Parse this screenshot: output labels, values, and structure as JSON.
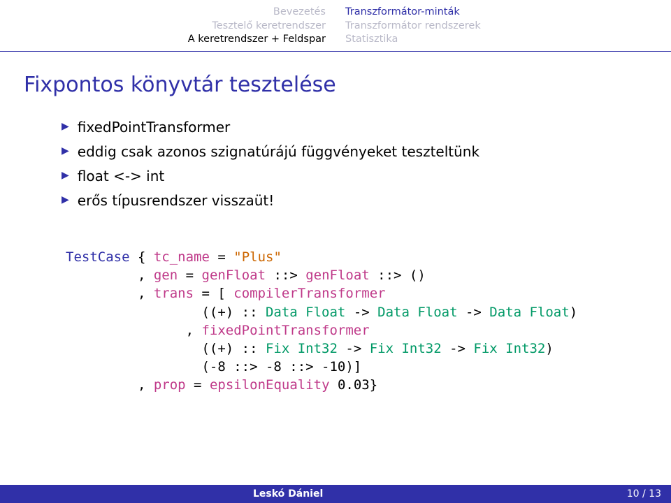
{
  "header": {
    "left": [
      "Bevezetés",
      "Tesztelő keretrendszer",
      "A keretrendszer + Feldspar"
    ],
    "right": [
      "Transzformátor-minták",
      "Transzformátor rendszerek",
      "Statisztika"
    ],
    "active_left_index": 2,
    "active_right_index": 0
  },
  "title": "Fixpontos könyvtár tesztelése",
  "bullets": [
    "fixedPointTransformer",
    "eddig csak azonos szignatúrájú függvényeket teszteltünk",
    "float <-> int",
    "erős típusrendszer visszaüt!"
  ],
  "code": {
    "l1_a": "TestCase",
    "l1_b": " { ",
    "l1_c": "tc_name",
    "l1_d": " = ",
    "l1_e": "\"Plus\"",
    "l2_a": "         , ",
    "l2_b": "gen",
    "l2_c": " = ",
    "l2_d": "genFloat",
    "l2_e": " ::> ",
    "l2_f": "genFloat",
    "l2_g": " ::> ()",
    "l3_a": "         , ",
    "l3_b": "trans",
    "l3_c": " = [ ",
    "l3_d": "compilerTransformer",
    "l4_a": "                 ((+) :: ",
    "l4_b": "Data Float",
    "l4_c": " -> ",
    "l4_d": "Data Float",
    "l4_e": " -> ",
    "l4_f": "Data Float",
    "l4_g": ")",
    "l5_a": "               , ",
    "l5_b": "fixedPointTransformer",
    "l6_a": "                 ((+) :: ",
    "l6_b": "Fix Int32",
    "l6_c": " -> ",
    "l6_d": "Fix Int32",
    "l6_e": " -> ",
    "l6_f": "Fix Int32",
    "l6_g": ")",
    "l7_a": "                 (-8 ::> -8 ::> -10)]",
    "l8_a": "         , ",
    "l8_b": "prop",
    "l8_c": " = ",
    "l8_d": "epsilonEquality",
    "l8_e": " 0.03}"
  },
  "footer": {
    "author": "Leskó Dániel",
    "page": "10 / 13"
  }
}
